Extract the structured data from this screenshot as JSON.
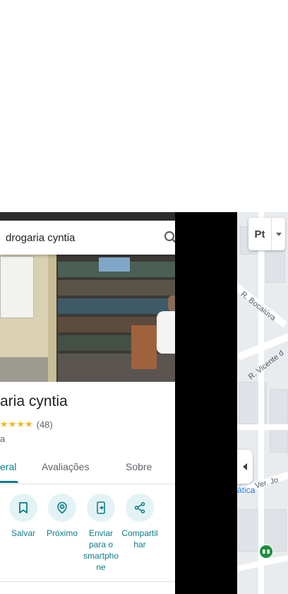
{
  "search": {
    "value": "drogaria cyntia"
  },
  "place": {
    "title": "aria cyntia",
    "rating_stars": 5,
    "review_count": "(48)",
    "category": "a"
  },
  "tabs": [
    {
      "label": "eral",
      "selected": true
    },
    {
      "label": "Avaliações",
      "selected": false
    },
    {
      "label": "Sobre",
      "selected": false
    }
  ],
  "actions": [
    {
      "label": "Salvar",
      "icon": "bookmark-icon"
    },
    {
      "label": "Próximo",
      "icon": "nearby-icon"
    },
    {
      "label": "Enviar para o smartphone",
      "icon": "send-to-phone-icon"
    },
    {
      "label": "Compartilhar",
      "icon": "share-icon"
    }
  ],
  "map": {
    "layer_button": "Pt",
    "streets": [
      "R. Bocaiúva",
      "R. Vicente d",
      "Ver. Jo"
    ],
    "poi": "ática"
  },
  "colors": {
    "accent": "#0b7c8a",
    "star": "#f3b818",
    "action_bg": "#e3f3f5",
    "map_bg": "#e9ecef"
  }
}
